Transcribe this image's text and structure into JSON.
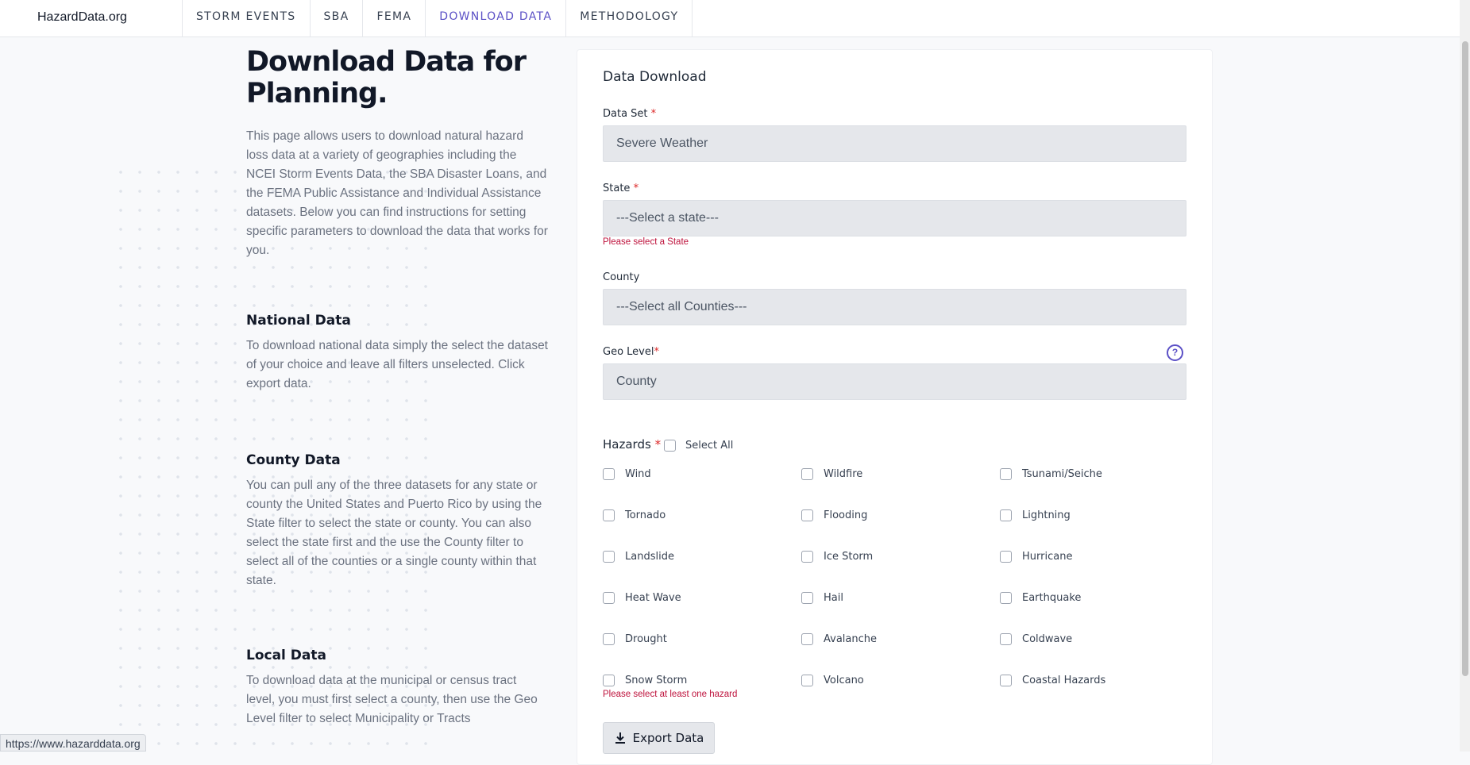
{
  "brand": "HazardData.org",
  "nav": {
    "tabs": [
      "STORM EVENTS",
      "SBA",
      "FEMA",
      "DOWNLOAD DATA",
      "METHODOLOGY"
    ],
    "active": "DOWNLOAD DATA"
  },
  "intro": {
    "title_line1": "Download Data for",
    "title_line2": "Planning.",
    "body": "This page allows users to download natural hazard loss data at a variety of geographies including the NCEI Storm Events Data, the SBA Disaster Loans, and the FEMA Public Assistance and Individual Assistance datasets. Below you can find instructions for setting specific parameters to download the data that works for you."
  },
  "sections": [
    {
      "heading": "National Data",
      "body": "To download national data simply the select the dataset of your choice and leave all filters unselected. Click export data."
    },
    {
      "heading": "County Data",
      "body": "You can pull any of the three datasets for any state or county the United States and Puerto Rico by using the State filter to select the state or county. You can also select the state first and the use the County filter to select all of the counties or a single county within that state."
    },
    {
      "heading": "Local Data",
      "body": "To download data at the municipal or census tract level, you must first select a county, then use the Geo Level filter to select Municipality or Tracts"
    }
  ],
  "form": {
    "title": "Data Download",
    "dataset": {
      "label": "Data Set",
      "required": "*",
      "value": "Severe Weather"
    },
    "state": {
      "label": "State",
      "required": "*",
      "value": "---Select a state---",
      "error": "Please select a State"
    },
    "county": {
      "label": "County",
      "value": "---Select all Counties---"
    },
    "geolevel": {
      "label": "Geo Level",
      "required": "*",
      "value": "County",
      "help": "?"
    },
    "hazards": {
      "label": "Hazards",
      "required": "*",
      "select_all": "Select All",
      "items": [
        "Wind",
        "Wildfire",
        "Tsunami/Seiche",
        "Tornado",
        "Flooding",
        "Lightning",
        "Landslide",
        "Ice Storm",
        "Hurricane",
        "Heat Wave",
        "Hail",
        "Earthquake",
        "Drought",
        "Avalanche",
        "Coldwave",
        "Snow Storm",
        "Volcano",
        "Coastal Hazards"
      ],
      "error": "Please select at least one hazard"
    },
    "export_label": "Export Data"
  },
  "status_url": "https://www.hazarddata.org",
  "colors": {
    "accent": "#5b50c6",
    "error": "#be123c"
  }
}
